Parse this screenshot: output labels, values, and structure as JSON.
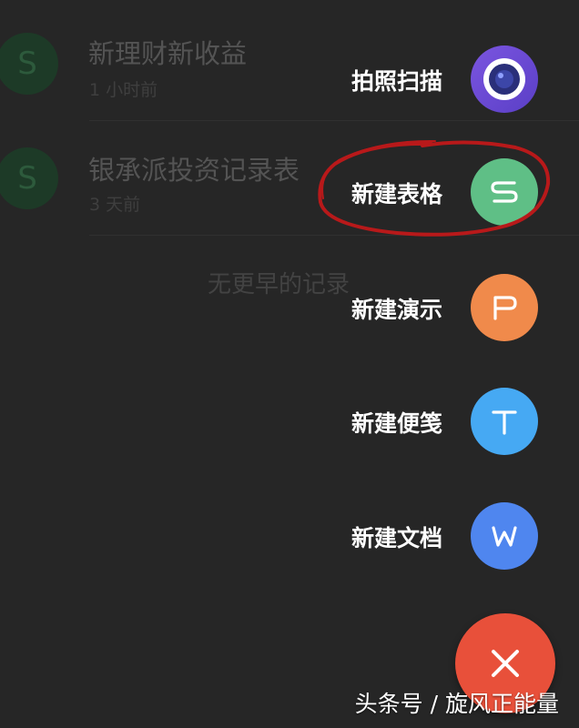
{
  "recent_files": [
    {
      "name": "新理财新收益",
      "time": "1 小时前",
      "icon": "sheet-s-icon"
    },
    {
      "name": "银承派投资记录表",
      "time": "3 天前",
      "icon": "sheet-s-icon"
    }
  ],
  "no_more_text": "无更早的记录",
  "fab_menu": {
    "items": [
      {
        "label": "拍照扫描",
        "icon": "camera-icon",
        "color": "#6a4ad6"
      },
      {
        "label": "新建表格",
        "icon": "sheet-s-icon",
        "color": "#5fbf86"
      },
      {
        "label": "新建演示",
        "icon": "presentation-p-icon",
        "color": "#f08a4b"
      },
      {
        "label": "新建便笺",
        "icon": "note-t-icon",
        "color": "#46a9f3"
      },
      {
        "label": "新建文档",
        "icon": "document-w-icon",
        "color": "#4f86ef"
      }
    ],
    "close_icon": "close-icon",
    "close_color": "#e8503a"
  },
  "annotation_color": "#b8191a",
  "watermark": "头条号 / 旋风正能量"
}
